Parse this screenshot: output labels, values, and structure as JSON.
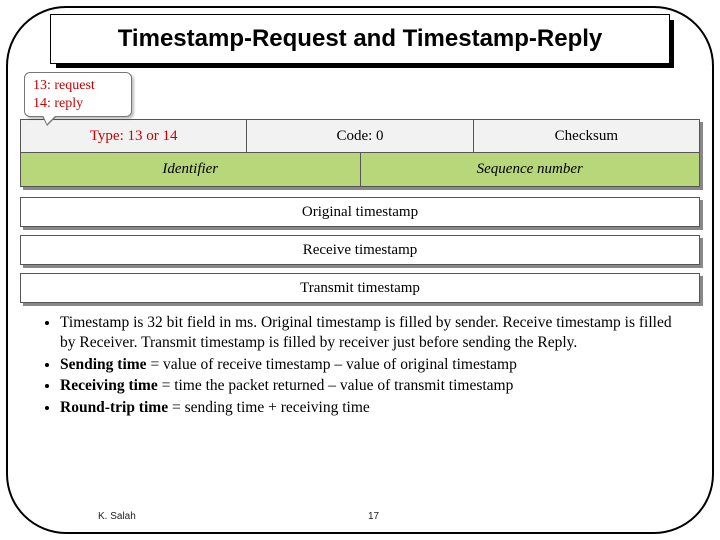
{
  "title": "Timestamp-Request and Timestamp-Reply",
  "callout": {
    "line1": "13: request",
    "line2": "14: reply"
  },
  "packet": {
    "row1": {
      "type": "Type: 13 or 14",
      "code": "Code: 0",
      "checksum": "Checksum"
    },
    "row2": {
      "identifier": "Identifier",
      "sequence": "Sequence number"
    },
    "timestamps": {
      "original": "Original timestamp",
      "receive": "Receive timestamp",
      "transmit": "Transmit timestamp"
    }
  },
  "bullets": {
    "b1": "Timestamp is 32 bit field in ms. Original timestamp is filled by sender. Receive timestamp is filled by Receiver. Transmit timestamp is filled by receiver just before sending the Reply.",
    "b2_lead": "Sending time",
    "b2_rest": " =  value of receive timestamp   –    value of original timestamp",
    "b3_lead": "Receiving time",
    "b3_rest": "  =  time the packet returned –  value of transmit timestamp",
    "b4_lead": "Round-trip time",
    "b4_rest": " = sending time + receiving time"
  },
  "footer": {
    "author": "K. Salah",
    "page": "17"
  }
}
